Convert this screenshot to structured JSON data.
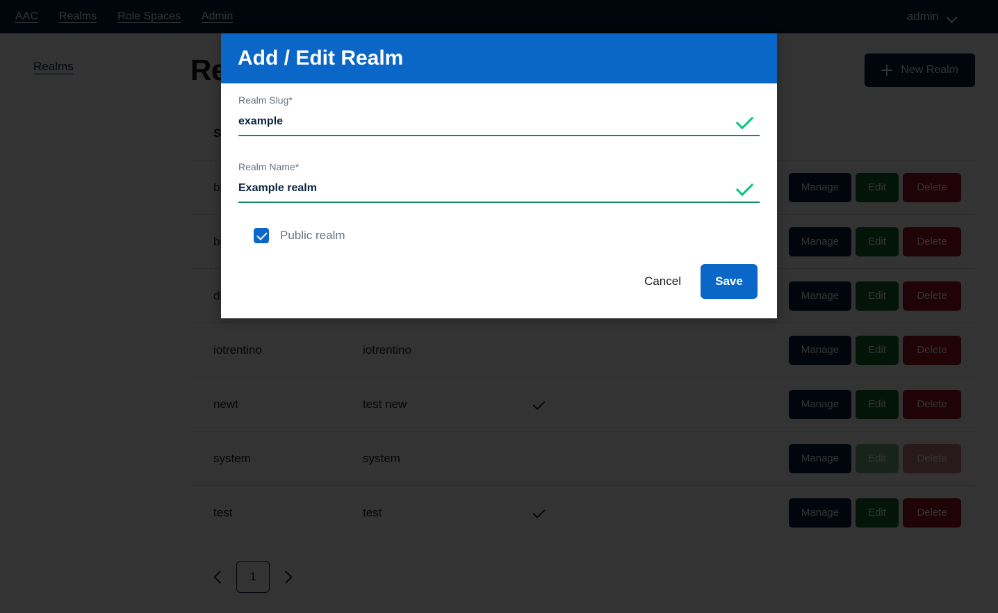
{
  "topbar": {
    "nav": [
      {
        "label": "AAC"
      },
      {
        "label": "Realms"
      },
      {
        "label": "Role Spaces"
      },
      {
        "label": "Admin"
      }
    ],
    "user": "admin",
    "user_menu_icon": "chevron-down-icon"
  },
  "sidebar": {
    "items": [
      {
        "label": "Realms"
      }
    ]
  },
  "main": {
    "title": "Realms",
    "new_button": {
      "label": "New Realm",
      "icon": "plus-icon"
    },
    "table": {
      "headers": [
        "Slug",
        "",
        "",
        ""
      ],
      "header_slug": "Slug",
      "rows": [
        {
          "slug": "blank",
          "name": "",
          "public": false,
          "manage": "Manage",
          "edit": "Edit",
          "delete": "Delete",
          "disabled": false
        },
        {
          "slug": "boot",
          "name": "",
          "public": false,
          "manage": "Manage",
          "edit": "Edit",
          "delete": "Delete",
          "disabled": false
        },
        {
          "slug": "digital",
          "name": "",
          "public": false,
          "manage": "Manage",
          "edit": "Edit",
          "delete": "Delete",
          "disabled": false
        },
        {
          "slug": "iotrentino",
          "name": "iotrentino",
          "public": false,
          "manage": "Manage",
          "edit": "Edit",
          "delete": "Delete",
          "disabled": false
        },
        {
          "slug": "newt",
          "name": "test new",
          "public": true,
          "manage": "Manage",
          "edit": "Edit",
          "delete": "Delete",
          "disabled": false
        },
        {
          "slug": "system",
          "name": "system",
          "public": false,
          "manage": "Manage",
          "edit": "Edit",
          "delete": "Delete",
          "disabled": true
        },
        {
          "slug": "test",
          "name": "test",
          "public": true,
          "manage": "Manage",
          "edit": "Edit",
          "delete": "Delete",
          "disabled": false
        }
      ]
    },
    "pagination": {
      "prev_icon": "chevron-left-icon",
      "next_icon": "chevron-right-icon",
      "current_page": "1"
    }
  },
  "modal": {
    "title": "Add / Edit Realm",
    "fields": [
      {
        "label": "Realm Slug*",
        "value": "example",
        "placeholder": "Realm Slug",
        "valid_icon": "check-icon"
      },
      {
        "label": "Realm Name*",
        "value": "Example realm",
        "placeholder": "Realm Name",
        "valid_icon": "check-icon"
      }
    ],
    "checkbox": {
      "label": "Public realm",
      "checked": true
    },
    "cancel_label": "Cancel",
    "save_label": "Save"
  },
  "colors": {
    "topbar_bg": "#011e39",
    "modal_header_blue": "#0a67c8",
    "valid_green": "#00c878",
    "field_underline": "#0f8a63",
    "manage_btn": "#011e39",
    "edit_btn": "#0a6b2c",
    "delete_btn": "#9b1220",
    "overlay": "rgba(0,0,0,0.80)"
  }
}
